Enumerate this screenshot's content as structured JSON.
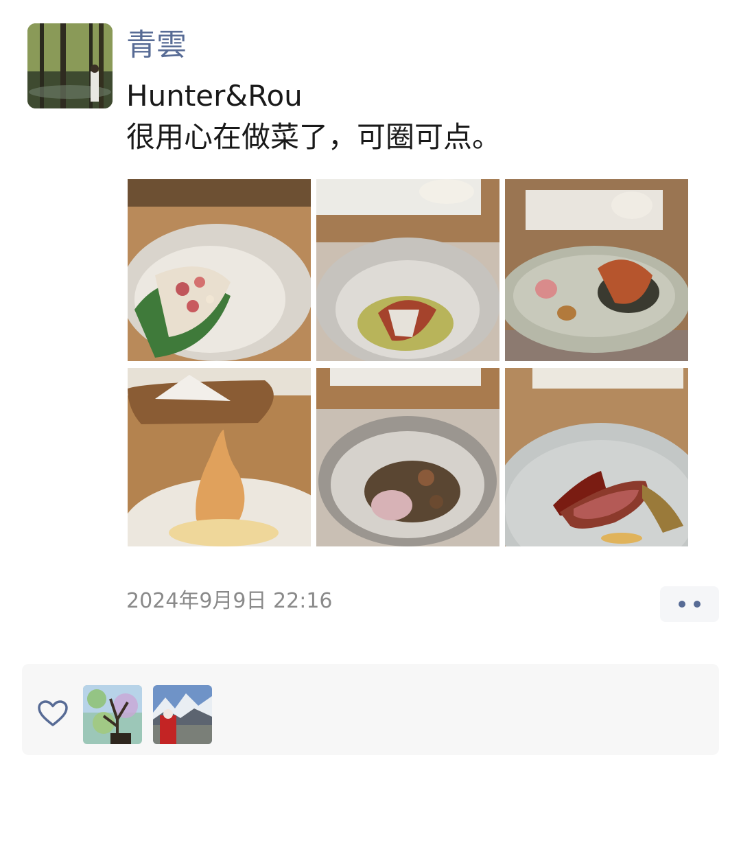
{
  "post": {
    "author": "青雲",
    "lines": [
      "Hunter&Rou",
      "很用心在做菜了，可圈可点。"
    ],
    "photos": [
      {
        "name": "photo-1"
      },
      {
        "name": "photo-2"
      },
      {
        "name": "photo-3"
      },
      {
        "name": "photo-4"
      },
      {
        "name": "photo-5"
      },
      {
        "name": "photo-6"
      }
    ],
    "timestamp": "2024年9月9日 22:16"
  },
  "likes": {
    "icon": "heart-icon",
    "avatars": [
      "liker-avatar-1",
      "liker-avatar-2"
    ]
  },
  "colors": {
    "nickname": "#576b95",
    "text": "#191919",
    "timestamp": "#8a8a8a",
    "panel": "#f7f7f7"
  }
}
